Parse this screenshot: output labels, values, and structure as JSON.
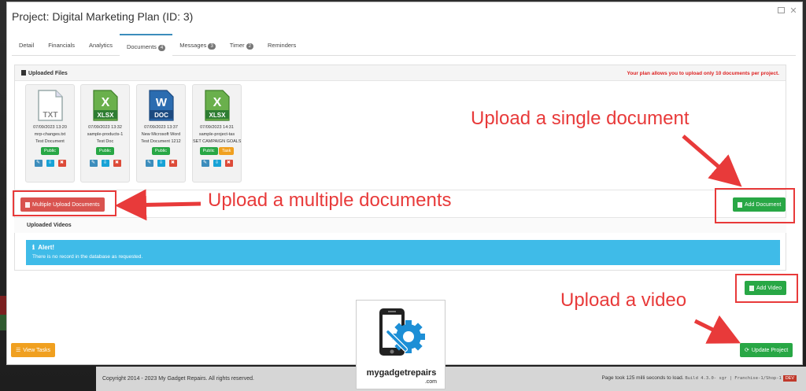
{
  "modal": {
    "title": "Project: Digital Marketing Plan (ID: 3)",
    "tabs": [
      {
        "label": "Detail"
      },
      {
        "label": "Financials"
      },
      {
        "label": "Analytics"
      },
      {
        "label": "Documents",
        "badge": "4"
      },
      {
        "label": "Messages",
        "badge": "3"
      },
      {
        "label": "Timer",
        "badge": "2"
      },
      {
        "label": "Reminders"
      }
    ]
  },
  "files_panel": {
    "heading": "Uploaded Files",
    "limit_note": "Your plan allows you to upload only 10 documents per project.",
    "files": [
      {
        "type": "TXT",
        "date": "07/09/2023 13:20",
        "name": "mrp-changes.txt",
        "desc": "Test Document",
        "tags": [
          "Public"
        ]
      },
      {
        "type": "XLSX",
        "date": "07/09/2023 13:32",
        "name": "sample-products-1",
        "desc": "Test Doc",
        "tags": [
          "Public"
        ]
      },
      {
        "type": "DOC",
        "date": "07/09/2023 13:37",
        "name": "New Microsoft Word",
        "desc": "Test Document 1212",
        "tags": [
          "Public"
        ]
      },
      {
        "type": "XLSX",
        "date": "07/09/2023 14:31",
        "name": "sample-project-tas",
        "desc": "SET CAMPAIGN GOALS",
        "tags": [
          "Public",
          "Task"
        ]
      }
    ]
  },
  "buttons": {
    "multiple_upload": "Multiple Upload Documents",
    "add_document": "Add Document",
    "add_video": "Add Video",
    "view_tasks": "View Tasks",
    "update_project": "Update Project"
  },
  "videos_panel": {
    "heading": "Uploaded Videos",
    "alert_title": "Alert!",
    "alert_message": "There is no record in the database as requested."
  },
  "footer": {
    "copyright": "Copyright 2014 - 2023 My Gadget Repairs. All rights reserved.",
    "load_time": "Page took 125 milli seconds to load.",
    "build": "Build 4.3.0- sgr | Franchise-1/Shop-1",
    "env": "DEV"
  },
  "annotations": {
    "single": "Upload a single document",
    "multiple": "Upload a multiple documents",
    "video": "Upload a video"
  },
  "logo": {
    "text": "mygadgetrepairs",
    "sub": ".com"
  },
  "colors": {
    "accent": "#3c8dbc",
    "green": "#28a745",
    "red": "#d9534f",
    "alert": "#3fbbe8",
    "annotation": "#e83a3a",
    "logo_blue": "#1d8fd6"
  }
}
